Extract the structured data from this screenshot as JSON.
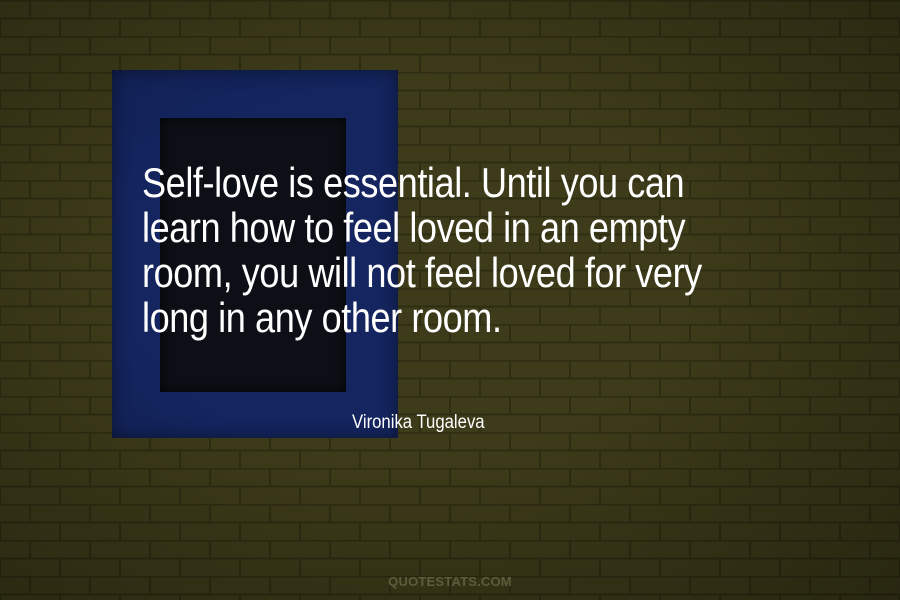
{
  "quote": {
    "text": "Self-love is essential. Until you can learn how to feel loved in an empty room, you will not feel loved for very long in any other room."
  },
  "author": {
    "name": "Vironika Tugaleva"
  },
  "watermark": {
    "text": "QUOTESTATS.COM"
  },
  "colors": {
    "wall": "#3c3a18",
    "window_frame": "#14255f",
    "window_glass": "#0d0f17",
    "text": "#ffffff"
  }
}
